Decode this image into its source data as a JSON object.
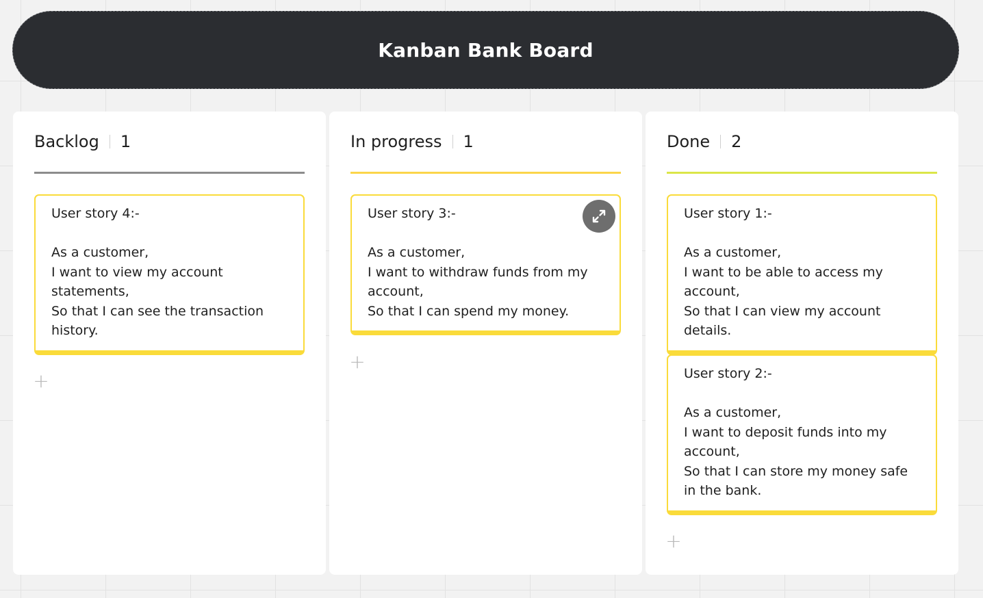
{
  "board": {
    "title": "Kanban Bank Board"
  },
  "columns": [
    {
      "name": "Backlog",
      "count": "1",
      "line_color": "#8c8c8c",
      "cards": [
        {
          "lines": [
            "User story 4:-",
            "",
            "As a customer,",
            "I want to view my account statements,",
            "So that I can see the transaction history."
          ]
        }
      ],
      "add_label": "+"
    },
    {
      "name": "In progress",
      "count": "1",
      "line_color": "#fbd54a",
      "cards": [
        {
          "lines": [
            "User story 3:-",
            "",
            "As a customer,",
            "I want to withdraw funds from my account,",
            "So that I can spend my money."
          ]
        }
      ],
      "add_label": "+"
    },
    {
      "name": "Done",
      "count": "2",
      "line_color": "#dbe649",
      "cards": [
        {
          "lines": [
            "User story 1:-",
            "",
            "As a customer,",
            "I want to be able to access my account,",
            "So that I can view my account details."
          ]
        },
        {
          "lines": [
            "User story 2:-",
            "",
            "As a customer,",
            "I want to deposit funds into my account,",
            "So that I can store my money safe in the bank."
          ]
        }
      ],
      "add_label": "+"
    }
  ],
  "icons": {
    "expand": "expand-arrows-icon"
  },
  "colors": {
    "title_bg": "#2b2d31",
    "card_border": "#fadb3a",
    "canvas_bg": "#f2f2f2"
  }
}
